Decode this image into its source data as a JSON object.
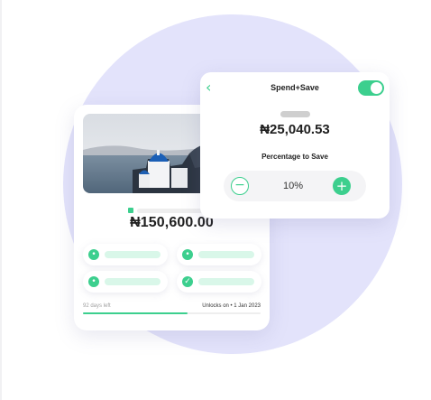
{
  "savings_card": {
    "amount": "₦150,600.00",
    "days_left": "92 days left",
    "unlocks": "Unlocks on • 1 Jan 2023",
    "progress_fraction": 0.59,
    "photo_icon": "santorini-photo"
  },
  "spend_save": {
    "title": "Spend+Save",
    "back_icon": "chevron-left-icon",
    "toggle_on": true,
    "amount": "₦25,040.53",
    "percentage_label": "Percentage to Save",
    "percentage_value": "10%",
    "minus_symbol": "−",
    "plus_symbol": "+"
  },
  "colors": {
    "accent": "#3ccf8e",
    "circle": "#e3e3fb"
  }
}
